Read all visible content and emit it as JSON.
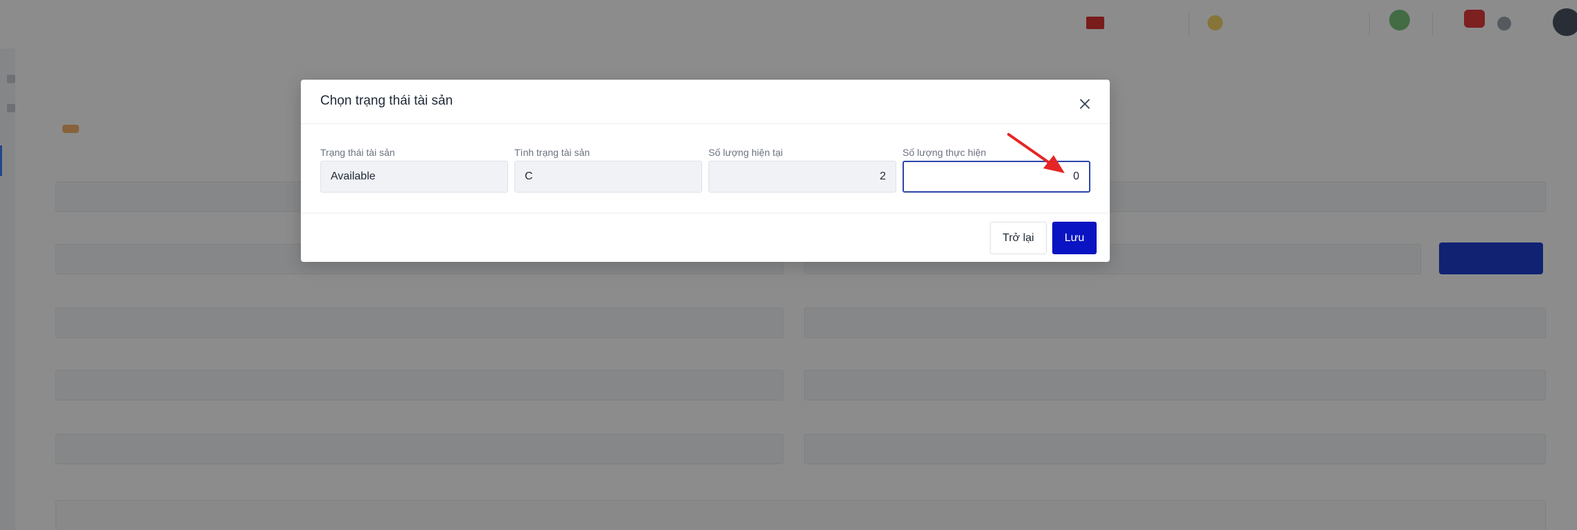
{
  "modal": {
    "title": "Chọn trạng thái tài sản",
    "fields": [
      {
        "label": "Trạng thái tài sản",
        "value": "Available"
      },
      {
        "label": "Tình trạng tài sản",
        "value": "C"
      },
      {
        "label": "Số lượng hiện tại",
        "value": "2"
      },
      {
        "label": "Số lượng thực hiện",
        "value": "0"
      }
    ],
    "buttons": {
      "back_label": "Trở lại",
      "save_label": "Lưu"
    }
  },
  "icons": {
    "close": "close-icon",
    "arrow": "red-arrow-annotation-icon"
  },
  "colors": {
    "primary": "#0a14c2",
    "active_border": "#2c46a8",
    "annotation": "#e52525"
  }
}
